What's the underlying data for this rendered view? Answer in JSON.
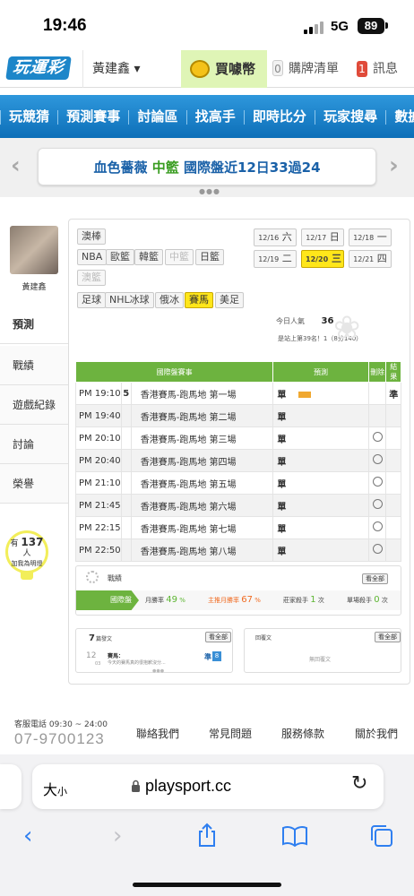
{
  "status": {
    "time": "19:46",
    "network": "5G",
    "battery": "89"
  },
  "header": {
    "logo": "玩運彩",
    "user": "黃建鑫 ▾",
    "buy": "買噱幣",
    "cart_count": "0",
    "cart_label": "購牌清單",
    "msg_count": "1",
    "msg_label": "訊息"
  },
  "nav": [
    "玩競猜",
    "預測賽事",
    "討論區",
    "找高手",
    "即時比分",
    "玩家搜尋",
    "數據"
  ],
  "banner": {
    "brand": "血色薔薇",
    "league": "中籃",
    "text": "國際盤近12日33過24"
  },
  "profile": {
    "name": "黃建鑫"
  },
  "side_tabs": [
    "預測",
    "戰績",
    "遊戲紀錄",
    "討論",
    "榮譽"
  ],
  "bulb": {
    "prefix": "有",
    "count": "137",
    "unit": "人",
    "suffix": "加我為明燈"
  },
  "sports": {
    "row1": [
      "澳棒"
    ],
    "row2": [
      "NBA",
      "歐籃",
      "韓籃",
      "中籃",
      "日籃"
    ],
    "row3": [
      "澳籃"
    ],
    "row4": [
      "足球",
      "NHL冰球",
      "俄冰",
      "賽馬",
      "美足"
    ]
  },
  "dates": [
    {
      "md": "12/16",
      "d": "六"
    },
    {
      "md": "12/17",
      "d": "日"
    },
    {
      "md": "12/18",
      "d": "一"
    },
    {
      "md": "12/19",
      "d": "二"
    },
    {
      "md": "12/20",
      "d": "三"
    },
    {
      "md": "12/21",
      "d": "四"
    }
  ],
  "popularity": {
    "label": "今日人氣",
    "value": "36",
    "rank": "是站上第39名！1（8分140）"
  },
  "table": {
    "headers": [
      "國際盤賽事",
      "預測",
      "刪除",
      "結果"
    ],
    "rows": [
      {
        "time": "PM 19:10",
        "num": "5",
        "game": "香港賽馬-跑馬地 第一場",
        "pick": "單",
        "result": "準"
      },
      {
        "time": "PM 19:40",
        "num": "",
        "game": "香港賽馬-跑馬地 第二場",
        "pick": "單",
        "result": ""
      },
      {
        "time": "PM 20:10",
        "num": "",
        "game": "香港賽馬-跑馬地 第三場",
        "pick": "單",
        "result": ""
      },
      {
        "time": "PM 20:40",
        "num": "",
        "game": "香港賽馬-跑馬地 第四場",
        "pick": "單",
        "result": ""
      },
      {
        "time": "PM 21:10",
        "num": "",
        "game": "香港賽馬-跑馬地 第五場",
        "pick": "單",
        "result": ""
      },
      {
        "time": "PM 21:45",
        "num": "",
        "game": "香港賽馬-跑馬地 第六場",
        "pick": "單",
        "result": ""
      },
      {
        "time": "PM 22:15",
        "num": "",
        "game": "香港賽馬-跑馬地 第七場",
        "pick": "單",
        "result": ""
      },
      {
        "time": "PM 22:50",
        "num": "",
        "game": "香港賽馬-跑馬地 第八場",
        "pick": "單",
        "result": ""
      }
    ]
  },
  "stats": {
    "label": "戰績",
    "more": "看全部",
    "area": "國際盤",
    "month_label": "月勝率",
    "month_val": "49",
    "month_unit": "%",
    "home_label": "主推月勝率",
    "home_val": "67",
    "home_unit": "%",
    "village_label": "莊家殺手",
    "village_val": "1",
    "village_unit": "次",
    "single_label": "單場殺手",
    "single_val": "0",
    "single_unit": "次"
  },
  "posts": {
    "count": "7",
    "label": "篇發文",
    "more": "看全部",
    "date": "12",
    "day": "03",
    "title": "賽馬：",
    "text": "今天的賽馬真的很抱歉沒分...",
    "pick": "準",
    "pick_count": "8"
  },
  "replies": {
    "label": "回覆文",
    "more": "看全部",
    "empty": "無回覆文"
  },
  "footer": {
    "service": "客服電話 09:30 ~ 24:00",
    "phone": "07-9700123",
    "links": [
      "聯絡我們",
      "常見問題",
      "服務條款",
      "關於我們"
    ]
  },
  "safari": {
    "aa": "大",
    "aa_small": "小",
    "url": "playsport.cc"
  }
}
